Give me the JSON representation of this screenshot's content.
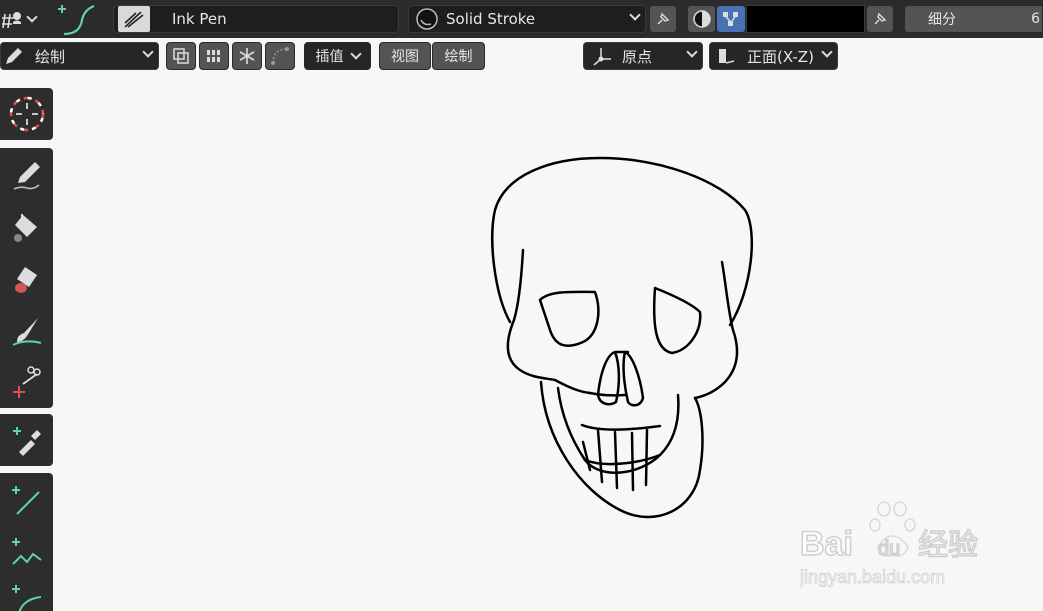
{
  "topbar": {
    "brush_name": "Ink Pen",
    "material_name": "Solid Stroke",
    "subdivide_label": "细分",
    "subdivide_value": "6",
    "color_hex": "#000000"
  },
  "toolbar": {
    "mode_label": "绘制",
    "interpolate_label": "插值",
    "view_label": "视图",
    "draw_label": "绘制",
    "origin_label": "原点",
    "plane_label": "正面(X-Z)"
  },
  "tools": [
    {
      "name": "cursor-tool",
      "icon": "cursor-icon"
    },
    {
      "name": "draw-tool",
      "icon": "pencil-icon"
    },
    {
      "name": "fill-tool",
      "icon": "bucket-icon"
    },
    {
      "name": "erase-tool",
      "icon": "eraser-icon"
    },
    {
      "name": "tint-tool",
      "icon": "brush-icon"
    },
    {
      "name": "cutter-tool",
      "icon": "scissors-icon"
    },
    {
      "name": "eyedropper-tool",
      "icon": "eyedropper-icon"
    },
    {
      "name": "line-tool",
      "icon": "line-icon"
    },
    {
      "name": "polyline-tool",
      "icon": "polyline-icon"
    },
    {
      "name": "arc-tool",
      "icon": "arc-icon"
    }
  ],
  "watermark": {
    "brand": "Bai",
    "brand2": "du",
    "sub": "经验",
    "url": "jingyan.baidu.com"
  }
}
